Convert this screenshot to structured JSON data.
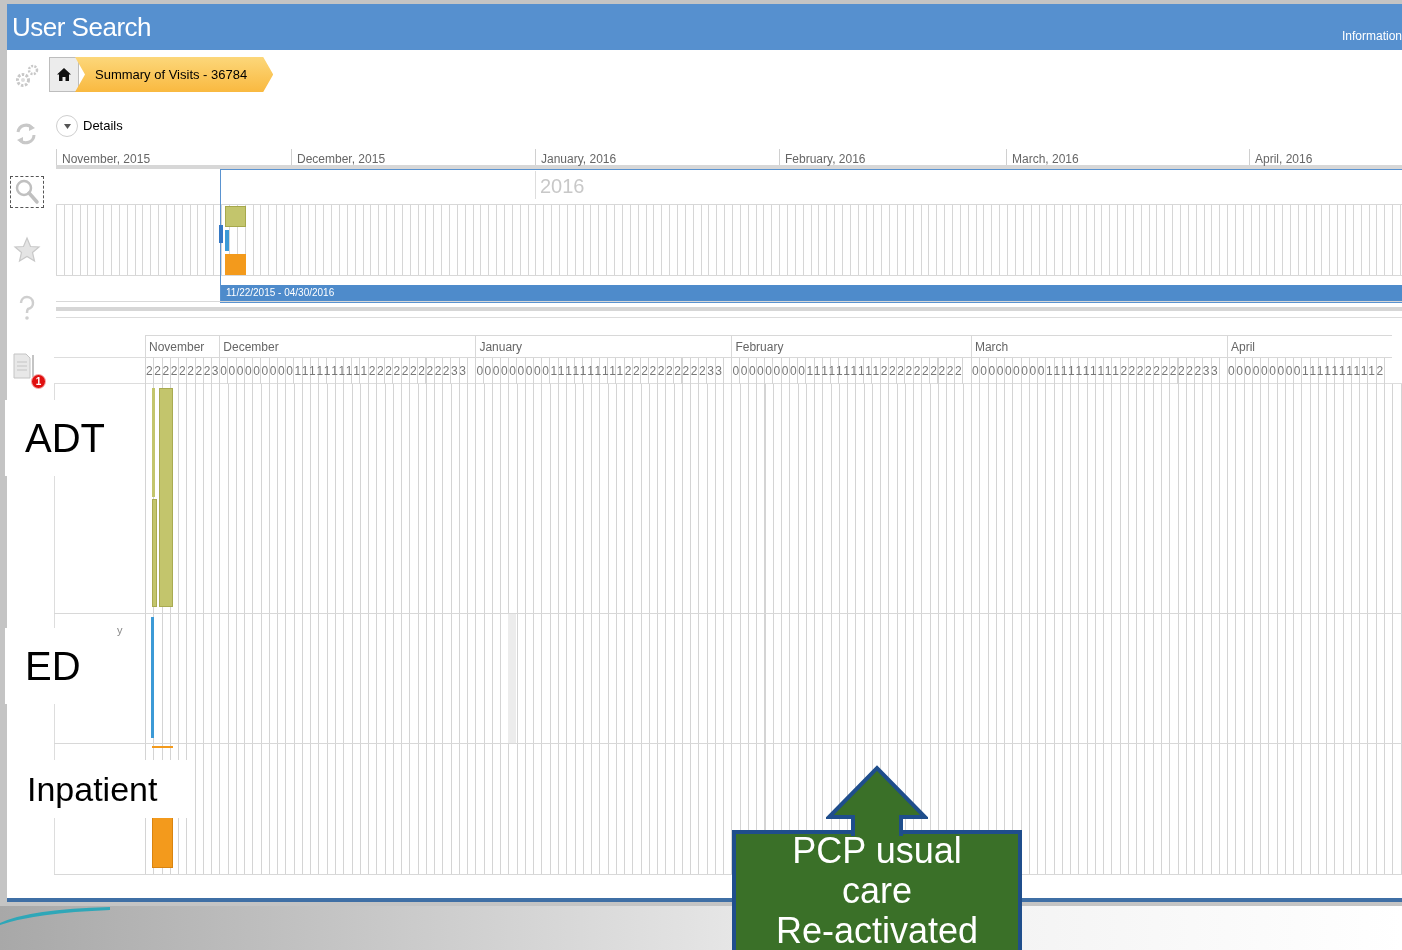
{
  "window": {
    "title": "User Search",
    "header_link": "Information"
  },
  "sidebar": {
    "items": [
      {
        "kind": "settings",
        "selected": false
      },
      {
        "kind": "refresh",
        "selected": false
      },
      {
        "kind": "search",
        "selected": true
      },
      {
        "kind": "favorites",
        "selected": false
      },
      {
        "kind": "help",
        "selected": false
      },
      {
        "kind": "document",
        "selected": false,
        "badge": "1"
      }
    ]
  },
  "breadcrumb": [
    {
      "kind": "home"
    },
    {
      "kind": "page",
      "label": "Summary of Visits - 36784"
    }
  ],
  "details": {
    "label": "Details",
    "expanded": false
  },
  "overview": {
    "months": [
      "November, 2015",
      "December, 2015",
      "January, 2016",
      "February, 2016",
      "March, 2016",
      "April, 2016"
    ],
    "year_label": "2016",
    "range": "11/22/2015 - 04/30/2016"
  },
  "gantt": {
    "months": [
      {
        "label": "November",
        "days": "222222223"
      },
      {
        "label": "December",
        "days": "0000000001111111111222222222233"
      },
      {
        "label": "January",
        "days": "0000000001111111111222222222233"
      },
      {
        "label": "February",
        "days": "00000000011111111112222222222"
      },
      {
        "label": "March",
        "days": "0000000001111111111222222222233"
      },
      {
        "label": "April",
        "days": "00000000011111111112"
      }
    ],
    "rows": [
      {
        "kind": "adt",
        "label": "ADT",
        "color": "#c3c56c"
      },
      {
        "kind": "ed",
        "label": "ED",
        "sub_label": "y",
        "color": "#3c9ad6"
      },
      {
        "kind": "inpatient",
        "label": "Inpatient",
        "color": "#f39a1c"
      }
    ]
  },
  "callout": {
    "text": "PCP usual\ncare\nRe-activated"
  }
}
